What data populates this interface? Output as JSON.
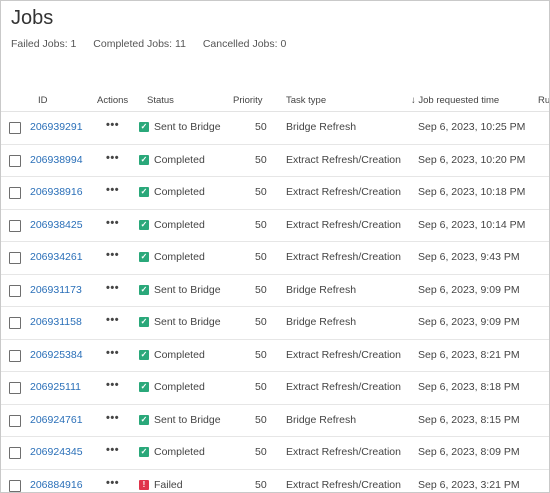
{
  "page": {
    "title": "Jobs"
  },
  "summary": {
    "failed": "Failed Jobs: 1",
    "completed": "Completed Jobs: 11",
    "cancelled": "Cancelled Jobs: 0"
  },
  "columns": {
    "id": "ID",
    "actions": "Actions",
    "status": "Status",
    "priority": "Priority",
    "task_type": "Task type",
    "requested": "↓ Job requested time",
    "run": "Ru"
  },
  "actions_glyph": "•••",
  "rows": [
    {
      "id": "206939291",
      "status": "Sent to Bridge",
      "status_icon": "check-icon",
      "priority": "50",
      "task_type": "Bridge Refresh",
      "requested": "Sep 6, 2023, 10:25 PM"
    },
    {
      "id": "206938994",
      "status": "Completed",
      "status_icon": "check-icon",
      "priority": "50",
      "task_type": "Extract Refresh/Creation",
      "requested": "Sep 6, 2023, 10:20 PM"
    },
    {
      "id": "206938916",
      "status": "Completed",
      "status_icon": "check-icon",
      "priority": "50",
      "task_type": "Extract Refresh/Creation",
      "requested": "Sep 6, 2023, 10:18 PM"
    },
    {
      "id": "206938425",
      "status": "Completed",
      "status_icon": "check-icon",
      "priority": "50",
      "task_type": "Extract Refresh/Creation",
      "requested": "Sep 6, 2023, 10:14 PM"
    },
    {
      "id": "206934261",
      "status": "Completed",
      "status_icon": "check-icon",
      "priority": "50",
      "task_type": "Extract Refresh/Creation",
      "requested": "Sep 6, 2023, 9:43 PM"
    },
    {
      "id": "206931173",
      "status": "Sent to Bridge",
      "status_icon": "check-icon",
      "priority": "50",
      "task_type": "Bridge Refresh",
      "requested": "Sep 6, 2023, 9:09 PM"
    },
    {
      "id": "206931158",
      "status": "Sent to Bridge",
      "status_icon": "check-icon",
      "priority": "50",
      "task_type": "Bridge Refresh",
      "requested": "Sep 6, 2023, 9:09 PM"
    },
    {
      "id": "206925384",
      "status": "Completed",
      "status_icon": "check-icon",
      "priority": "50",
      "task_type": "Extract Refresh/Creation",
      "requested": "Sep 6, 2023, 8:21 PM"
    },
    {
      "id": "206925111",
      "status": "Completed",
      "status_icon": "check-icon",
      "priority": "50",
      "task_type": "Extract Refresh/Creation",
      "requested": "Sep 6, 2023, 8:18 PM"
    },
    {
      "id": "206924761",
      "status": "Sent to Bridge",
      "status_icon": "check-icon",
      "priority": "50",
      "task_type": "Bridge Refresh",
      "requested": "Sep 6, 2023, 8:15 PM"
    },
    {
      "id": "206924345",
      "status": "Completed",
      "status_icon": "check-icon",
      "priority": "50",
      "task_type": "Extract Refresh/Creation",
      "requested": "Sep 6, 2023, 8:09 PM"
    },
    {
      "id": "206884916",
      "status": "Failed",
      "status_icon": "error-icon",
      "priority": "50",
      "task_type": "Extract Refresh/Creation",
      "requested": "Sep 6, 2023, 3:21 PM"
    }
  ],
  "colors": {
    "link": "#2a6fb8",
    "success": "#2aa87a",
    "error": "#e0344b"
  }
}
